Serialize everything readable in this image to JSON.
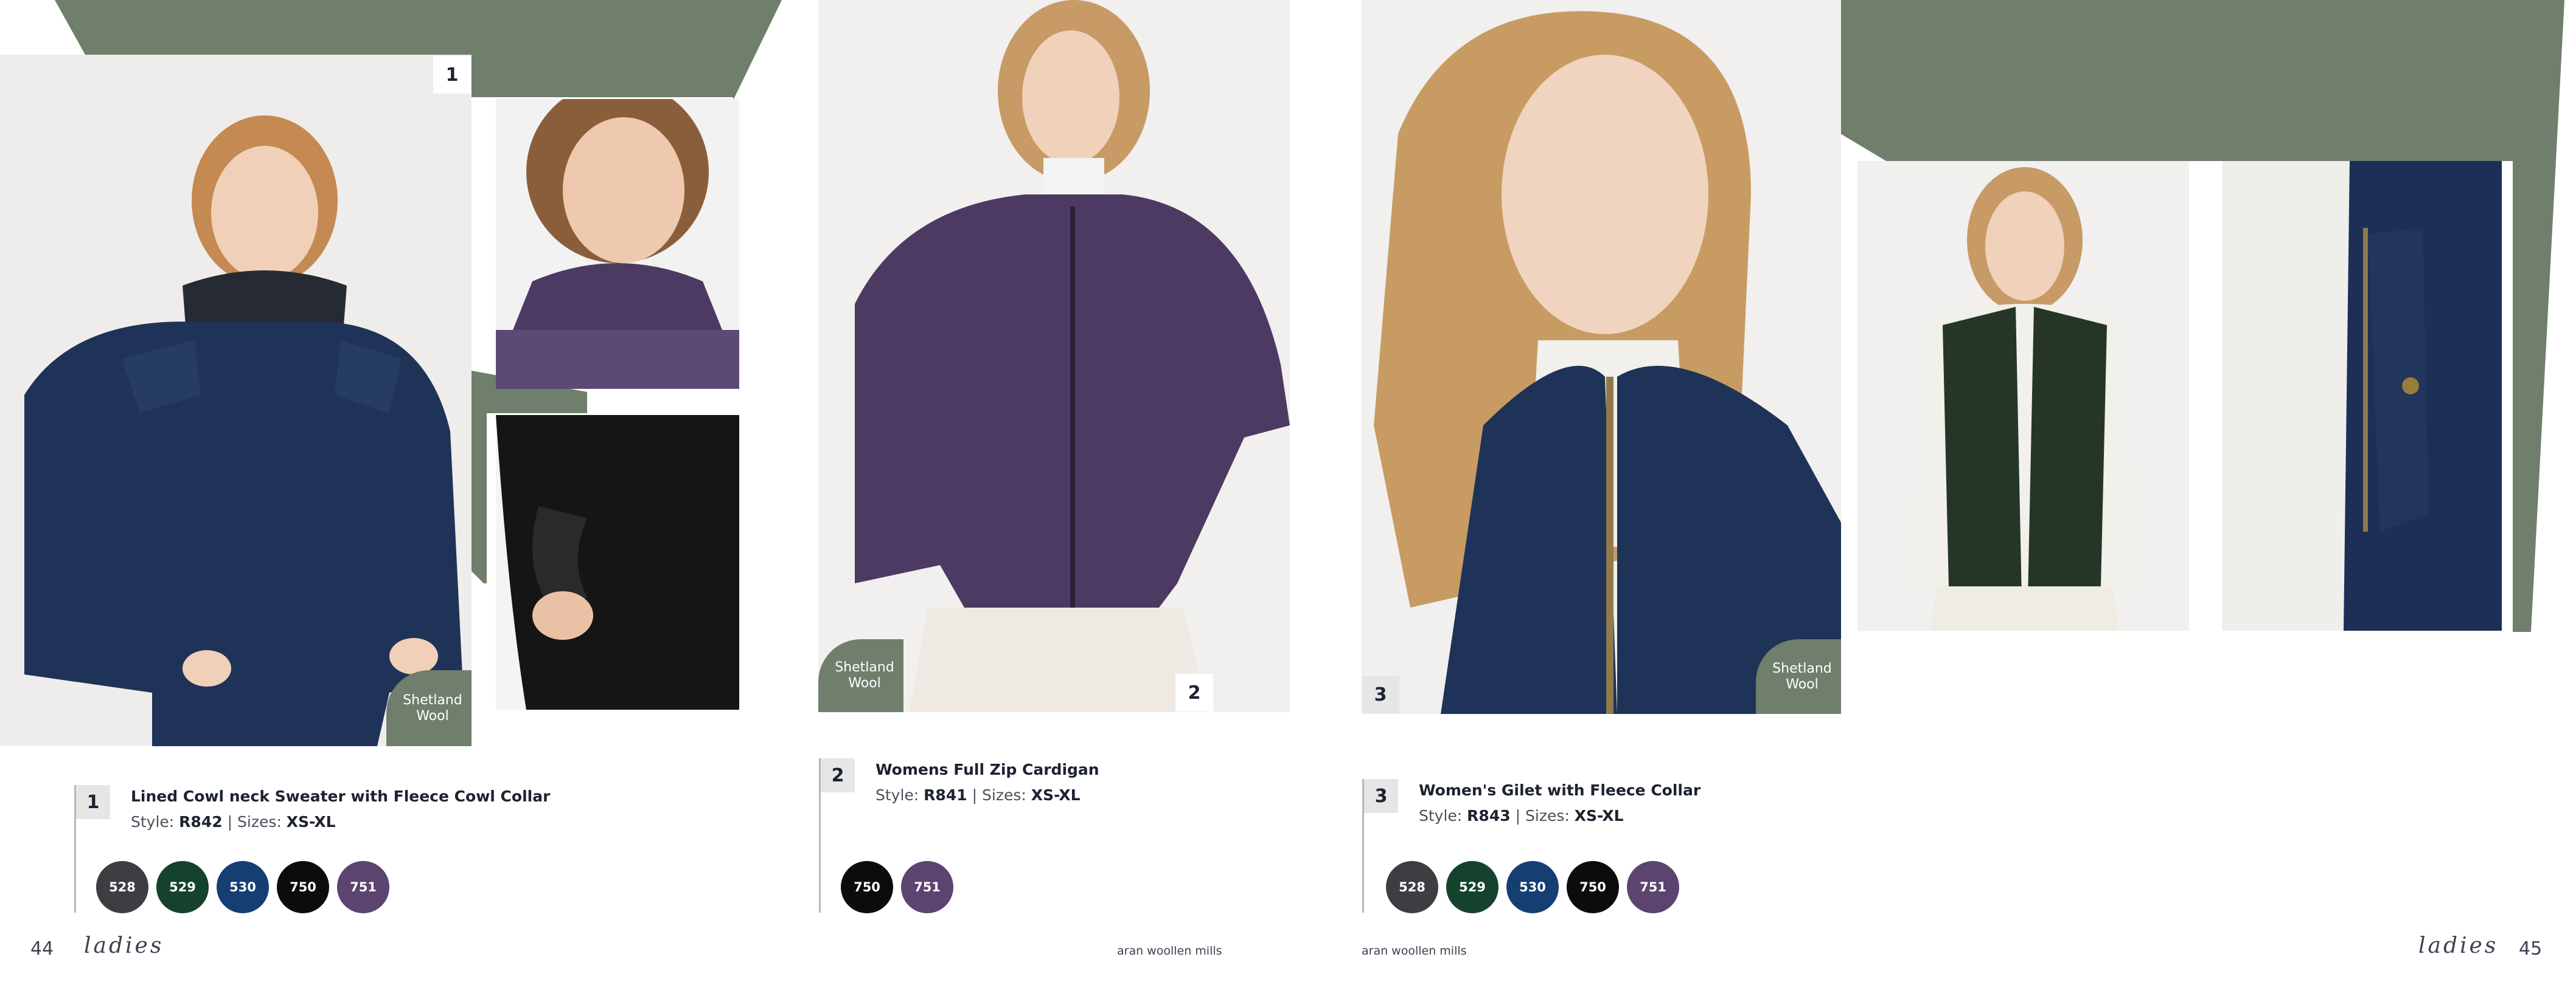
{
  "colors": {
    "accent_green": "#6f7f6c",
    "text_dark": "#1c2230",
    "sweater_navy": "#1f3358",
    "cardigan_purple": "#4c3a62",
    "gilet_green": "#253627"
  },
  "pages": {
    "left_folio": "44",
    "right_folio": "45",
    "left_section": "ladies",
    "right_section": "ladies",
    "brand_left": "aran woollen mills",
    "brand_right": "aran woollen mills"
  },
  "photos": {
    "p1_badge": "1",
    "p2_badge": "2",
    "p3_badge": "3",
    "wool_tag_1": [
      "Shetland",
      "Wool"
    ],
    "wool_tag_2": [
      "Shetland",
      "Wool"
    ],
    "wool_tag_3": [
      "Shetland",
      "Wool"
    ]
  },
  "products": [
    {
      "number": "1",
      "title": "Lined Cowl neck Sweater with Fleece Cowl Collar",
      "style_label": "Style:",
      "style_code": "R842",
      "sizes_label": "Sizes:",
      "sizes": "XS-XL",
      "swatches": [
        {
          "code": "528",
          "color": "#3d3e42"
        },
        {
          "code": "529",
          "color": "#15422d"
        },
        {
          "code": "530",
          "color": "#153f73"
        },
        {
          "code": "750",
          "color": "#0c0c0c"
        },
        {
          "code": "751",
          "color": "#5b4470"
        }
      ]
    },
    {
      "number": "2",
      "title": "Womens Full Zip Cardigan",
      "style_label": "Style:",
      "style_code": "R841",
      "sizes_label": "Sizes:",
      "sizes": "XS-XL",
      "swatches": [
        {
          "code": "750",
          "color": "#0c0c0c"
        },
        {
          "code": "751",
          "color": "#5b4470"
        }
      ]
    },
    {
      "number": "3",
      "title": "Women's Gilet with Fleece Collar",
      "style_label": "Style:",
      "style_code": "R843",
      "sizes_label": "Sizes:",
      "sizes": "XS-XL",
      "swatches": [
        {
          "code": "528",
          "color": "#3d3e42"
        },
        {
          "code": "529",
          "color": "#15422d"
        },
        {
          "code": "530",
          "color": "#153f73"
        },
        {
          "code": "750",
          "color": "#0c0c0c"
        },
        {
          "code": "751",
          "color": "#5b4470"
        }
      ]
    }
  ]
}
